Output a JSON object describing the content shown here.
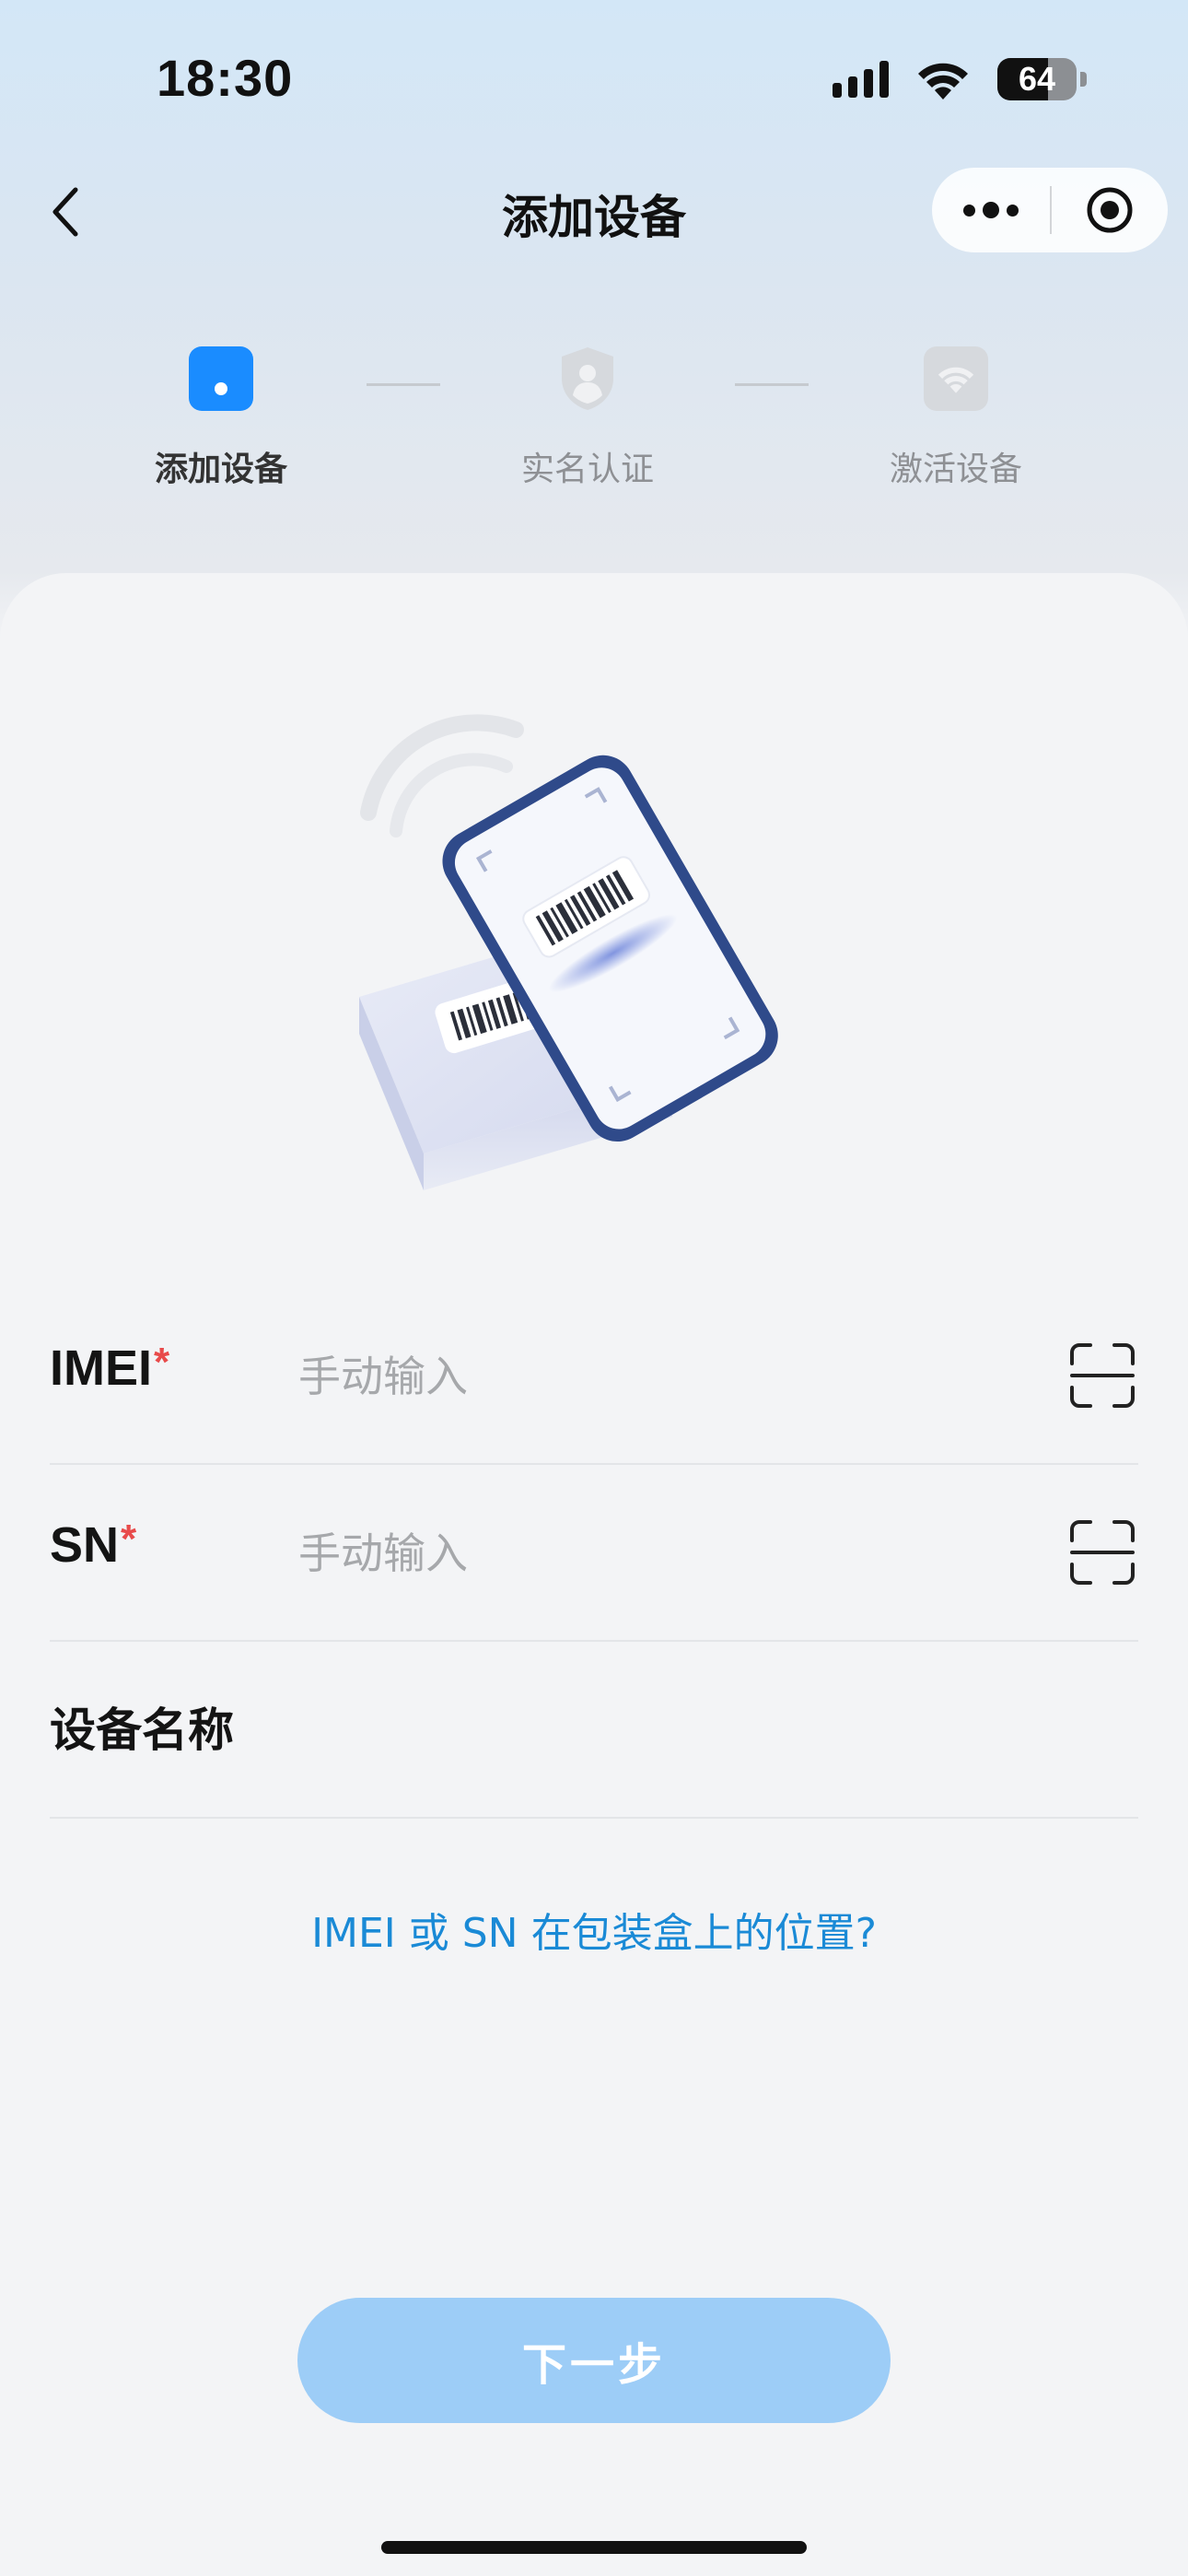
{
  "status_bar": {
    "time": "18:30",
    "battery_percent": "64"
  },
  "nav": {
    "title": "添加设备"
  },
  "steps": [
    {
      "label": "添加设备",
      "state": "active"
    },
    {
      "label": "实名认证",
      "state": "pending"
    },
    {
      "label": "激活设备",
      "state": "pending"
    }
  ],
  "form": {
    "imei": {
      "label": "IMEI",
      "required_mark": "*",
      "placeholder": "手动输入",
      "value": ""
    },
    "sn": {
      "label": "SN",
      "required_mark": "*",
      "placeholder": "手动输入",
      "value": ""
    },
    "device_name": {
      "label": "设备名称"
    }
  },
  "help_link": "IMEI 或 SN 在包装盒上的位置?",
  "next_button": "下一步",
  "colors": {
    "accent": "#1a8cff",
    "link": "#1a8ad6",
    "button_disabled": "#9dcdf7",
    "required": "#e84b4b"
  }
}
